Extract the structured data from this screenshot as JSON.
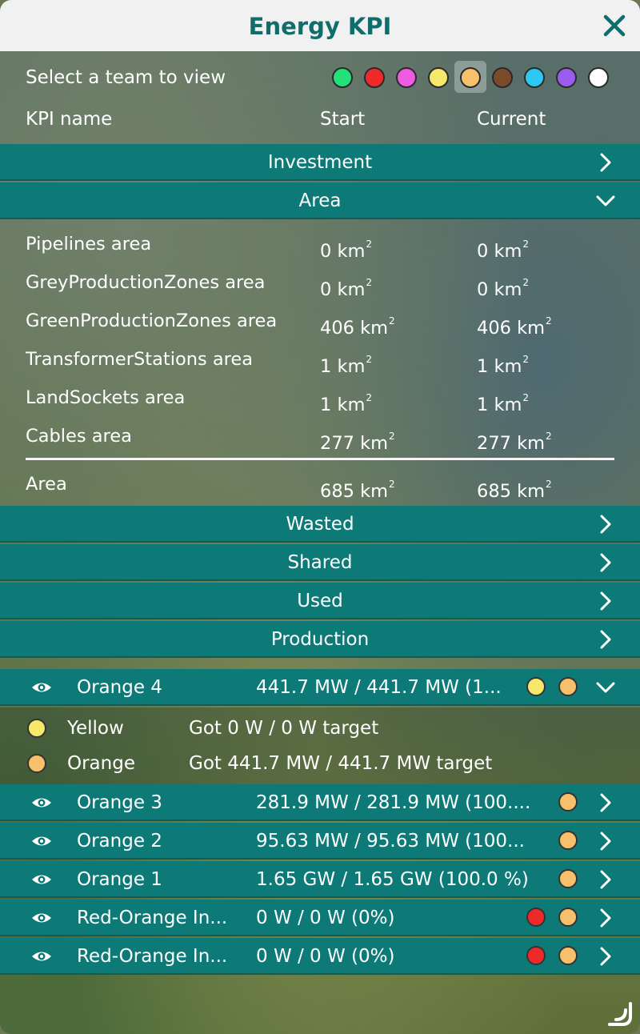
{
  "window": {
    "title": "Energy KPI"
  },
  "colors": {
    "accent": "#0d7a78",
    "title_text": "#0f6e6c"
  },
  "team_selector": {
    "label": "Select a team to view",
    "teams": [
      {
        "color": "#22e07a"
      },
      {
        "color": "#f02a2a"
      },
      {
        "color": "#ef5ae0"
      },
      {
        "color": "#f5e86a"
      },
      {
        "color": "#f7c06a",
        "selected": true
      },
      {
        "color": "#7a4a2a"
      },
      {
        "color": "#2ec8f5"
      },
      {
        "color": "#9b5cf0"
      },
      {
        "color": "#ffffff"
      }
    ]
  },
  "table_header": {
    "kpi_name": "KPI name",
    "start": "Start",
    "current": "Current"
  },
  "sections": {
    "investment": "Investment",
    "area": "Area",
    "wasted": "Wasted",
    "shared": "Shared",
    "used": "Used",
    "production": "Production"
  },
  "area_rows": [
    {
      "name": "Pipelines area",
      "start": "0 km",
      "current": "0 km"
    },
    {
      "name": "GreyProductionZones area",
      "start": "0 km",
      "current": "0 km"
    },
    {
      "name": "GreenProductionZones area",
      "start": "406 km",
      "current": "406 km"
    },
    {
      "name": "TransformerStations area",
      "start": "1 km",
      "current": "1 km"
    },
    {
      "name": "LandSockets area",
      "start": "1 km",
      "current": "1 km"
    },
    {
      "name": "Cables area",
      "start": "277 km",
      "current": "277 km"
    }
  ],
  "area_total": {
    "name": "Area",
    "start": "685 km",
    "current": "685 km"
  },
  "unit_superscript": "2",
  "production_rows": [
    {
      "name": "Orange 4",
      "value": "441.7 MW / 441.7 MW (1...",
      "dots": [
        "#f5e86a",
        "#f7c06a"
      ],
      "expanded": true
    },
    {
      "name": "Orange 3",
      "value": "281.9 MW / 281.9 MW (100....",
      "dots": [
        "#f7c06a"
      ]
    },
    {
      "name": "Orange 2",
      "value": "95.63 MW / 95.63 MW (100...",
      "dots": [
        "#f7c06a"
      ]
    },
    {
      "name": "Orange 1",
      "value": "1.65 GW / 1.65 GW (100.0 %)",
      "dots": [
        "#f7c06a"
      ]
    },
    {
      "name": "Red-Orange In...",
      "value": "0 W / 0 W (0%)",
      "dots": [
        "#f02a2a",
        "#f7c06a"
      ]
    },
    {
      "name": "Red-Orange In...",
      "value": "0 W / 0 W (0%)",
      "dots": [
        "#f02a2a",
        "#f7c06a"
      ]
    }
  ],
  "production_detail": [
    {
      "team": "Yellow",
      "color": "#f5e86a",
      "text": "Got 0 W / 0 W target"
    },
    {
      "team": "Orange",
      "color": "#f7c06a",
      "text": "Got 441.7 MW / 441.7 MW target"
    }
  ]
}
